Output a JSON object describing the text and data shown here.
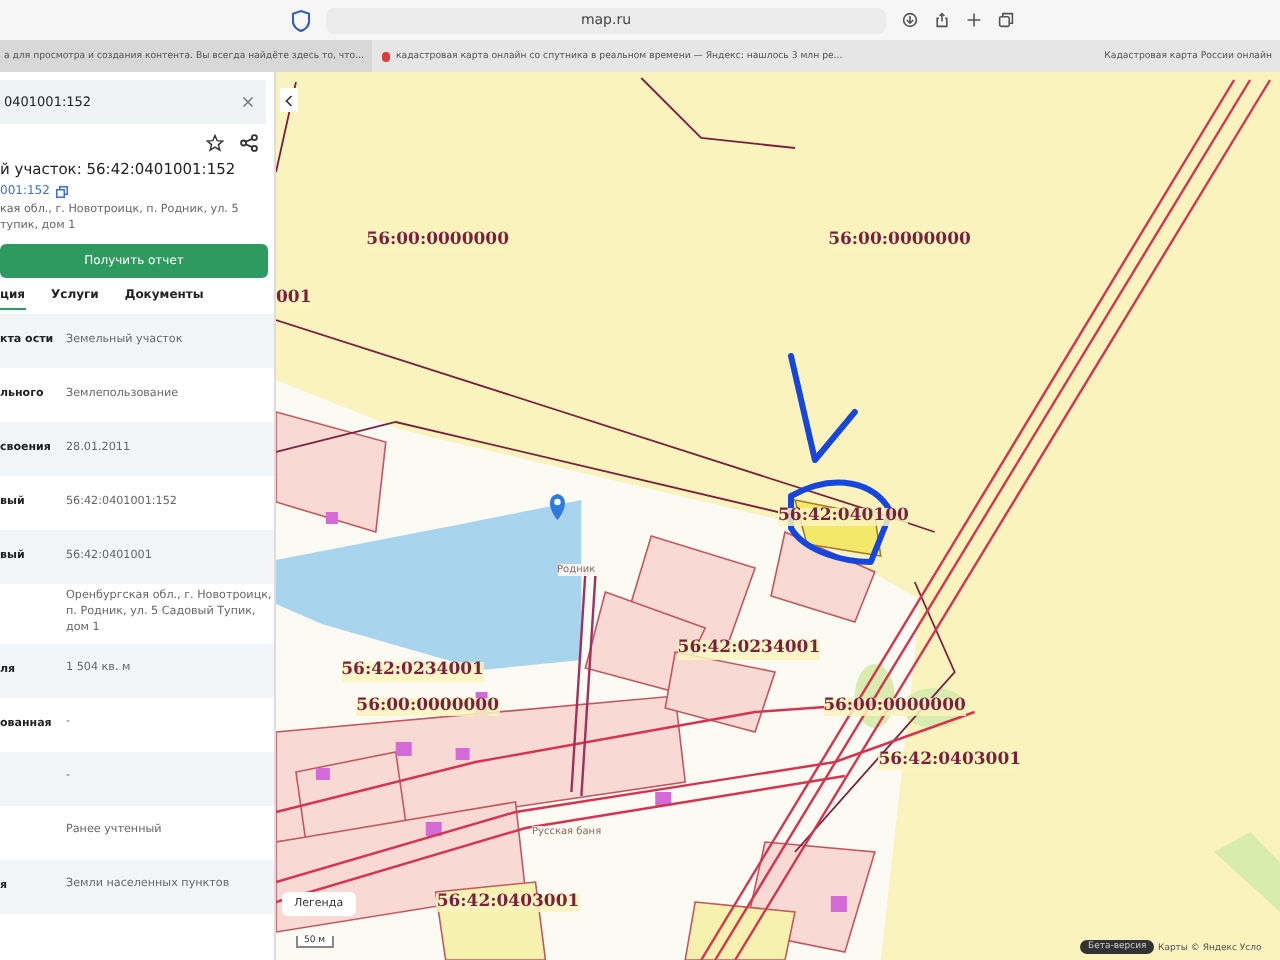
{
  "browser": {
    "url": "map.ru",
    "tabs": [
      {
        "title": "а для просмотра и создания контента. Вы всегда найдёте здесь то, что...",
        "selected": true
      },
      {
        "title": "кадастровая карта онлайн со спутника в реальном времени — Яндекс: нашлось 3 млн ре...",
        "selected": false
      }
    ],
    "bookmark": "Кадастровая карта России онлайн"
  },
  "panel": {
    "search": {
      "value": "0401001:152"
    },
    "title": "й участок: 56:42:0401001:152",
    "number_link": "001:152",
    "address": "кая обл., г. Новотроицк, п. Родник, ул. 5 тупик, дом 1",
    "report_button": "Получить отчет",
    "tabs": [
      {
        "label": "ция",
        "selected": true
      },
      {
        "label": "Услуги",
        "selected": false
      },
      {
        "label": "Документы",
        "selected": false
      }
    ],
    "rows": [
      {
        "label": "кта ости",
        "value": "Земельный участок"
      },
      {
        "label": "льного",
        "value": "Землепользование"
      },
      {
        "label": "своения",
        "value": "28.01.2011"
      },
      {
        "label": "вый",
        "value": "56:42:0401001:152"
      },
      {
        "label": "вый",
        "value": "56:42:0401001"
      },
      {
        "label": "",
        "value": "Оренбургская обл., г. Новотроицк, п. Родник, ул. 5 Садовый Тупик, дом 1"
      },
      {
        "label": "ля",
        "value": "1 504 кв. м"
      },
      {
        "label": "ованная",
        "value": "-"
      },
      {
        "label": "",
        "value": "-"
      },
      {
        "label": "",
        "value": "Ранее учтенный"
      },
      {
        "label": "я",
        "value": "Земли населенных пунктов"
      }
    ]
  },
  "map": {
    "labels": [
      "56:00:0000000",
      "56:00:0000000",
      "001",
      "56:42:040100",
      "56:42:0234001",
      "56:42:0234001",
      "56:00:0000000",
      "56:00:0000000",
      "56:42:0403001",
      "56:42:0403001"
    ],
    "places": [
      "Родник",
      "Русская баня"
    ],
    "legend_button": "Легенда",
    "scale": "50 м",
    "beta_badge": "Бета-версия",
    "attribution": "Карты © Яндекс Усло"
  }
}
